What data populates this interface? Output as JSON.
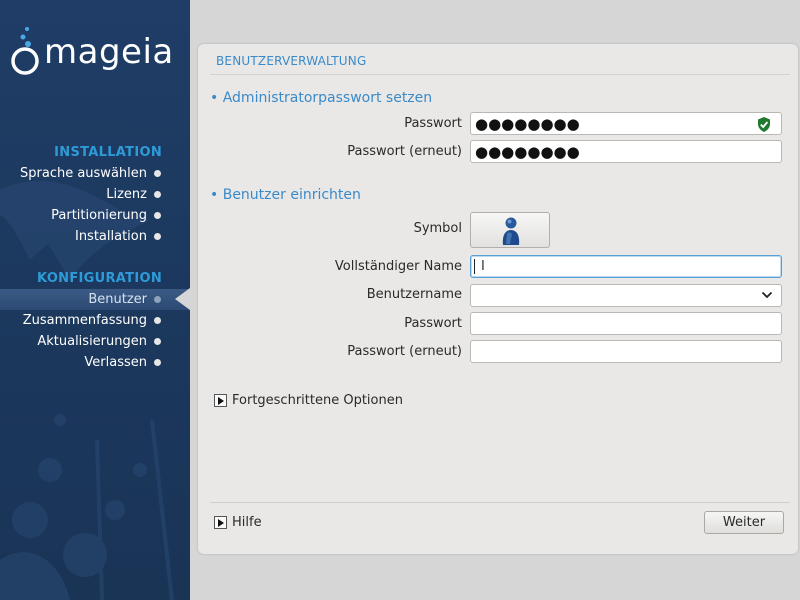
{
  "sidebar": {
    "logo_text": "mageia",
    "sections": [
      {
        "title": "INSTALLATION",
        "steps": [
          {
            "label": "Sprache auswählen"
          },
          {
            "label": "Lizenz"
          },
          {
            "label": "Partitionierung"
          },
          {
            "label": "Installation"
          }
        ]
      },
      {
        "title": "KONFIGURATION",
        "steps": [
          {
            "label": "Benutzer",
            "active": true
          },
          {
            "label": "Zusammenfassung"
          },
          {
            "label": "Aktualisierungen"
          },
          {
            "label": "Verlassen"
          }
        ]
      }
    ]
  },
  "panel": {
    "title": "BENUTZERVERWALTUNG",
    "admin": {
      "heading": "• Administratorpasswort setzen",
      "password_label": "Passwort",
      "password_value": "●●●●●●●●",
      "password_repeat_label": "Passwort (erneut)",
      "password_repeat_value": "●●●●●●●●",
      "strength_icon": "green-shield-check-icon"
    },
    "user": {
      "heading": "• Benutzer einrichten",
      "symbol_label": "Symbol",
      "fullname_label": "Vollständiger Name",
      "fullname_value": "",
      "username_label": "Benutzername",
      "username_value": "",
      "password_label": "Passwort",
      "password_value": "",
      "password_repeat_label": "Passwort (erneut)",
      "password_repeat_value": ""
    },
    "advanced_label": "Fortgeschrittene Optionen",
    "help_label": "Hilfe",
    "next_label": "Weiter"
  },
  "colors": {
    "sidebar_bg": "#1f3d66",
    "accent_blue": "#3a8ac9",
    "section_blue": "#2e9bd8",
    "panel_bg": "#e9e8e6",
    "desktop_bg": "#d6d6d6"
  }
}
